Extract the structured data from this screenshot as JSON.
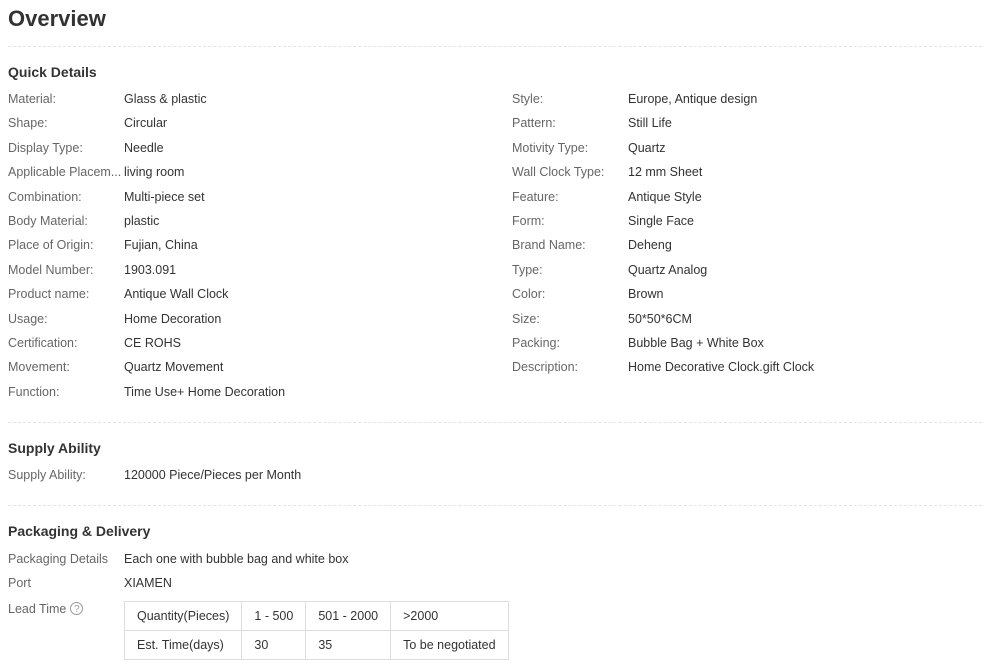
{
  "overview_title": "Overview",
  "quick_details": {
    "title": "Quick Details",
    "left": [
      {
        "label": "Material:",
        "value": "Glass & plastic"
      },
      {
        "label": "Shape:",
        "value": "Circular"
      },
      {
        "label": "Display Type:",
        "value": "Needle"
      },
      {
        "label": "Applicable Placem...",
        "value": "living room"
      },
      {
        "label": "Combination:",
        "value": "Multi-piece set"
      },
      {
        "label": "Body Material:",
        "value": "plastic"
      },
      {
        "label": "Place of Origin:",
        "value": "Fujian, China"
      },
      {
        "label": "Model Number:",
        "value": "1903.091"
      },
      {
        "label": "Product name:",
        "value": "Antique Wall Clock"
      },
      {
        "label": "Usage:",
        "value": "Home Decoration"
      },
      {
        "label": "Certification:",
        "value": "CE ROHS"
      },
      {
        "label": "Movement:",
        "value": "Quartz Movement"
      },
      {
        "label": "Function:",
        "value": "Time Use+ Home Decoration"
      }
    ],
    "right": [
      {
        "label": "Style:",
        "value": "Europe, Antique design"
      },
      {
        "label": "Pattern:",
        "value": "Still Life"
      },
      {
        "label": "Motivity Type:",
        "value": "Quartz"
      },
      {
        "label": "Wall Clock Type:",
        "value": "12 mm Sheet"
      },
      {
        "label": "Feature:",
        "value": "Antique Style"
      },
      {
        "label": "Form:",
        "value": "Single Face"
      },
      {
        "label": "Brand Name:",
        "value": "Deheng"
      },
      {
        "label": "Type:",
        "value": "Quartz Analog"
      },
      {
        "label": "Color:",
        "value": "Brown"
      },
      {
        "label": "Size:",
        "value": "50*50*6CM"
      },
      {
        "label": "Packing:",
        "value": "Bubble Bag + White Box"
      },
      {
        "label": "Description:",
        "value": "Home Decorative Clock.gift Clock"
      }
    ]
  },
  "supply_ability": {
    "title": "Supply Ability",
    "label": "Supply Ability:",
    "value": "120000 Piece/Pieces per Month"
  },
  "packaging_delivery": {
    "title": "Packaging & Delivery",
    "details_label": "Packaging Details",
    "details_value": "Each one with bubble bag and white box",
    "port_label": "Port",
    "port_value": "XIAMEN",
    "lead_time_label": "Lead Time",
    "help_icon_glyph": "?",
    "lead_table": {
      "header": [
        "Quantity(Pieces)",
        "1 - 500",
        "501 - 2000",
        ">2000"
      ],
      "row": [
        "Est. Time(days)",
        "30",
        "35",
        "To be negotiated"
      ]
    }
  }
}
